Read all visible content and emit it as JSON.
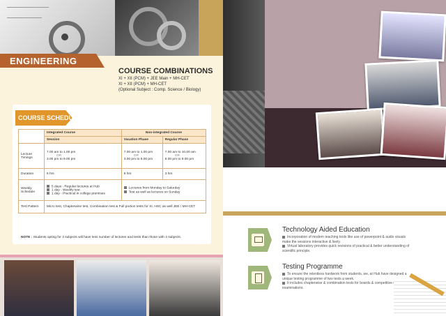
{
  "left_page": {
    "section_label": "ENGINEERING",
    "course_combinations": {
      "title": "COURSE COMBINATIONS",
      "lines": [
        "XI + XII (PCM) + JEE Main + MH-CET",
        "XI + XII (PCM) + MH-CET",
        "(Optional Subject : Comp. Science / Biology)"
      ]
    },
    "schedule": {
      "title": "COURSE SCHEDULE",
      "headers": {
        "integrated": "Integrated Course",
        "non_integrated": "Non-integrated Course",
        "session": "Session",
        "vacation": "Vacation Phase",
        "regular": "Regular Phase"
      },
      "rows": {
        "timings": {
          "label": "Lecture Timings",
          "integrated_a": "7.00 am to 1.00 pm",
          "integrated_b": "3.00 pm to 9.00 pm",
          "vacation_a": "7.00 am to 1.00 pm",
          "vacation_b": "3.00 pm to 9.00 pm",
          "regular_a": "7.00 am to 10.00 am",
          "regular_b": "6.00 pm to 9.00 pm",
          "or": "OR"
        },
        "duration": {
          "label": "Duration",
          "integrated": "6 hrs",
          "vacation": "6 hrs",
          "regular": "3 hrs"
        },
        "weekly": {
          "label": "Weekly Schedule",
          "integrated": [
            "5 days  - Regular lectures at Hub",
            "1 day   - Weekly test",
            "1 day   - Practical in college premises"
          ],
          "non_integrated": [
            "Lectures from Monday to Saturday",
            "Test as well as lectures on Sunday"
          ]
        },
        "test": {
          "label": "Test Pattern",
          "text": "Micro test, Chapterwise test, Combination test & Full portion tests for XI, HSC as well JEE / MH-CET"
        }
      },
      "note_label": "NOTE :",
      "note_text": "Students opting for 3 subjects will have less number of lectures and tests than those with 4 subjects."
    }
  },
  "right_page": {
    "features": [
      {
        "title": "Technology Aided Education",
        "icon": "presentation-icon",
        "points": [
          "Incorporation of modern teaching tools like use of powerpoint & audio visuals make the sessions interactive & lively.",
          "Virtual laboratory provides quick revisions of practical & better understanding of scientific principle."
        ]
      },
      {
        "title": "Testing Programme",
        "icon": "test-paper-icon",
        "points": [
          "To ensure the relentless hardwork from students, we, at Hub have designed a unique testing programme of two tests a week.",
          "It includes chapterwise & combination tests for boards & competitive entrance examinations."
        ]
      }
    ]
  },
  "colors": {
    "accent_brown": "#b5622f",
    "accent_orange": "#e0962a",
    "cream": "#fbf3dc",
    "mauve": "#b8a2a8",
    "gold": "#c9a45c",
    "icon_green": "#9fb77a"
  }
}
